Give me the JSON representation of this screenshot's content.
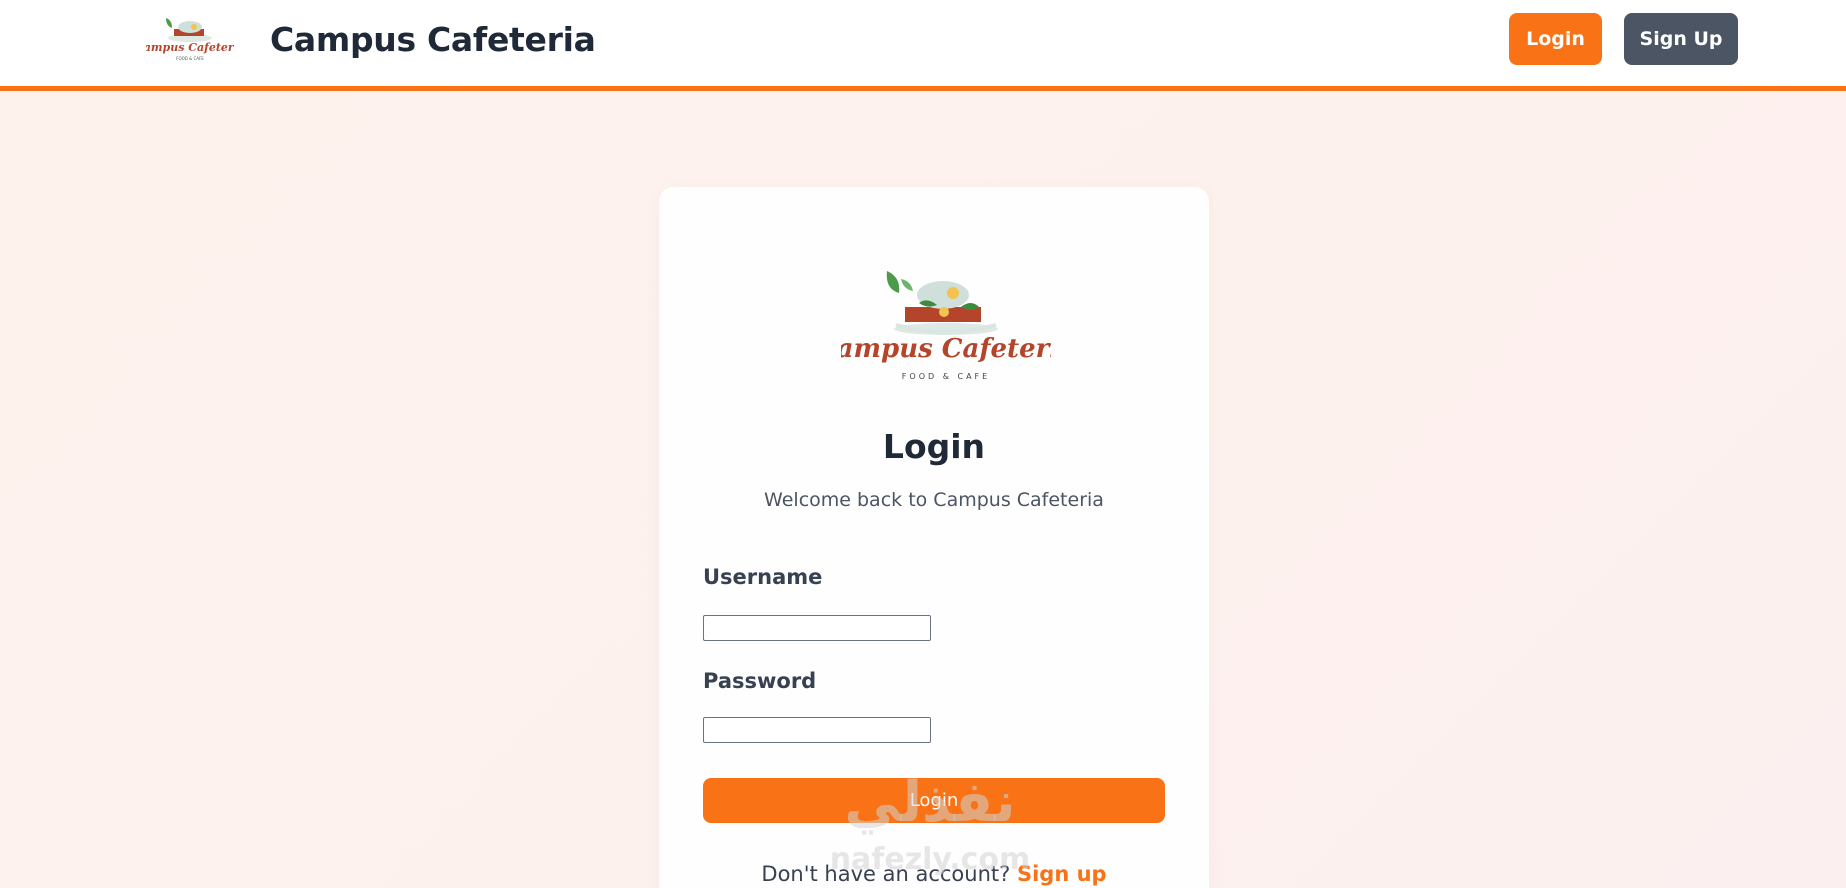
{
  "header": {
    "brand_name": "Campus Cafeteria",
    "logo_text": "Campus Cafeteria",
    "logo_tagline": "FOOD & CAFE",
    "login_label": "Login",
    "signup_label": "Sign Up"
  },
  "card": {
    "logo_text": "Campus Cafeteria",
    "logo_tagline": "FOOD & CAFE",
    "title": "Login",
    "subtitle": "Welcome back to Campus Cafeteria",
    "username_label": "Username",
    "username_value": "",
    "password_label": "Password",
    "password_value": "",
    "submit_label": "Login",
    "footer_prompt": "Don't have an account? ",
    "footer_link": "Sign up"
  },
  "watermark": {
    "script_text": "نفذلي",
    "url_text": "nafezly.com"
  },
  "colors": {
    "accent": "#f97316",
    "secondary_button": "#4b5563",
    "logo_red": "#b4452a",
    "leaf_green": "#4c9a4a"
  },
  "icons": {
    "brand_logo": "cafeteria-logo",
    "card_logo": "cafeteria-logo"
  }
}
